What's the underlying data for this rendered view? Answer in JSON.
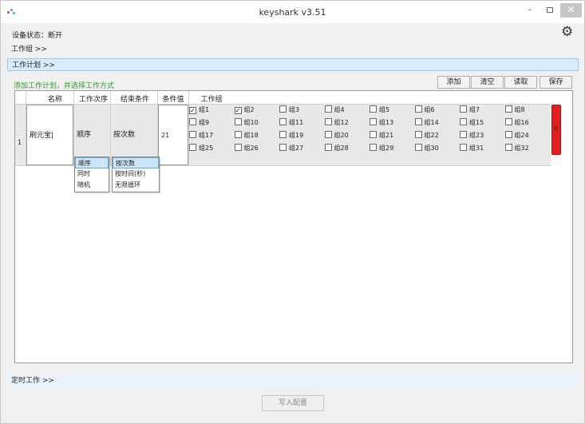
{
  "window": {
    "title": "keyshark v3.51",
    "minimize": "–",
    "close": "✕"
  },
  "status": {
    "label": "设备状态：",
    "value": "断开"
  },
  "sections": {
    "work_group": "工作组 >>",
    "work_plan": "工作计划 >>",
    "timed_work": "定时工作 >>"
  },
  "plan": {
    "hint": "添加工作计划，并选择工作方式",
    "buttons": {
      "add": "添加",
      "clear": "清空",
      "read": "读取",
      "save": "保存"
    }
  },
  "table": {
    "headers": {
      "name": "名称",
      "order": "工作次序",
      "end": "结束条件",
      "value": "条件值",
      "group": "工作组"
    },
    "row": {
      "num": "1",
      "name": "刷元宝|",
      "order": "顺序",
      "end": "按次数",
      "value": "21"
    }
  },
  "groups": [
    {
      "label": "组1",
      "checked": true
    },
    {
      "label": "组2",
      "checked": true
    },
    {
      "label": "组3",
      "checked": false
    },
    {
      "label": "组4",
      "checked": false
    },
    {
      "label": "组5",
      "checked": false
    },
    {
      "label": "组6",
      "checked": false
    },
    {
      "label": "组7",
      "checked": false
    },
    {
      "label": "组8",
      "checked": false
    },
    {
      "label": "组9",
      "checked": false
    },
    {
      "label": "组10",
      "checked": false
    },
    {
      "label": "组11",
      "checked": false
    },
    {
      "label": "组12",
      "checked": false
    },
    {
      "label": "组13",
      "checked": false
    },
    {
      "label": "组14",
      "checked": false
    },
    {
      "label": "组15",
      "checked": false
    },
    {
      "label": "组16",
      "checked": false
    },
    {
      "label": "组17",
      "checked": false
    },
    {
      "label": "组18",
      "checked": false
    },
    {
      "label": "组19",
      "checked": false
    },
    {
      "label": "组20",
      "checked": false
    },
    {
      "label": "组21",
      "checked": false
    },
    {
      "label": "组22",
      "checked": false
    },
    {
      "label": "组23",
      "checked": false
    },
    {
      "label": "组24",
      "checked": false
    },
    {
      "label": "组25",
      "checked": false
    },
    {
      "label": "组26",
      "checked": false
    },
    {
      "label": "组27",
      "checked": false
    },
    {
      "label": "组28",
      "checked": false
    },
    {
      "label": "组29",
      "checked": false
    },
    {
      "label": "组30",
      "checked": false
    },
    {
      "label": "组31",
      "checked": false
    },
    {
      "label": "组32",
      "checked": false
    }
  ],
  "order_options": [
    "顺序",
    "同时",
    "随机"
  ],
  "end_options": [
    "按次数",
    "按时间(秒)",
    "无限循环"
  ],
  "delete_mark": "x",
  "write_button": "写入配置",
  "icons": {
    "settings": "gear-icon",
    "app": "keyshark-logo-icon"
  },
  "colors": {
    "accent": "#d9ecfb",
    "hint": "#2e9a2e",
    "delete": "#e02020"
  }
}
